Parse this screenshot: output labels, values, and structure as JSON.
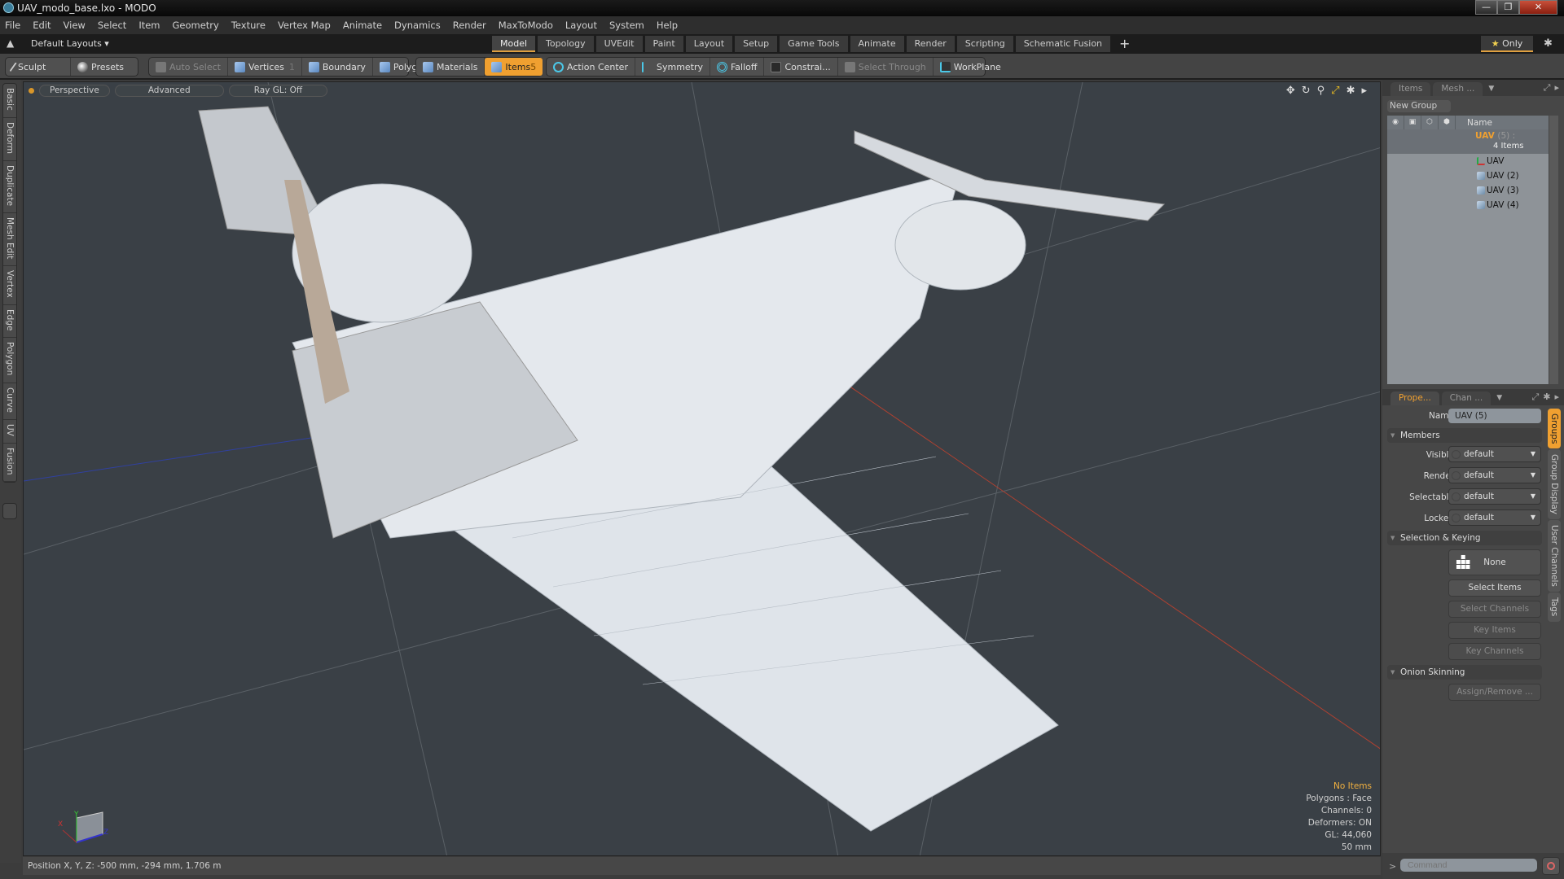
{
  "window": {
    "title": "UAV_modo_base.lxo - MODO",
    "min": "—",
    "max": "❐",
    "close": "✕"
  },
  "menu": [
    "File",
    "Edit",
    "View",
    "Select",
    "Item",
    "Geometry",
    "Texture",
    "Vertex Map",
    "Animate",
    "Dynamics",
    "Render",
    "MaxToModo",
    "Layout",
    "System",
    "Help"
  ],
  "layoutbar": {
    "layouts_label": "Default Layouts ▾",
    "tabs": [
      "Model",
      "Topology",
      "UVEdit",
      "Paint",
      "Layout",
      "Setup",
      "Game Tools",
      "Animate",
      "Render",
      "Scripting",
      "Schematic Fusion"
    ],
    "active_tab": "Model",
    "add": "+",
    "only_label": "Only",
    "star": "★",
    "gear": "✱"
  },
  "toolbar": {
    "sculpt": "Sculpt",
    "presets": "Presets",
    "auto_select": "Auto Select",
    "vertices": "Vertices",
    "vertices_count": "1",
    "boundary": "Boundary",
    "polygons": "Polygons",
    "materials": "Materials",
    "items": "Items",
    "items_count": "5",
    "action_center": "Action Center",
    "symmetry": "Symmetry",
    "falloff": "Falloff",
    "constraints": "Constrai...",
    "select_through": "Select Through",
    "workplane": "WorkPlane"
  },
  "left_tabs": [
    "Basic",
    "Deform",
    "Duplicate",
    "Mesh Edit",
    "Vertex",
    "Edge",
    "Polygon",
    "Curve",
    "UV",
    "Fusion"
  ],
  "viewport": {
    "view_mode": "Perspective",
    "shading": "Advanced",
    "raygl": "Ray GL: Off",
    "icons": [
      "move-icon",
      "rotate-icon",
      "zoom-icon",
      "maximize-icon",
      "gear-icon",
      "play-icon"
    ],
    "info": {
      "selection": "No Items",
      "polygons": "Polygons : Face",
      "channels": "Channels: 0",
      "deformers": "Deformers: ON",
      "gl": "GL: 44,060",
      "lens": "50 mm"
    },
    "axes": {
      "x": "X",
      "y": "Y",
      "z": "Z"
    }
  },
  "status": {
    "position": "Position X, Y, Z:   -500 mm, -294 mm, 1.706 m"
  },
  "items_panel": {
    "tabs": [
      "Items",
      "Mesh ..."
    ],
    "new_group": "New Group",
    "col_name": "Name",
    "group": {
      "name": "UAV",
      "count": "(5) :",
      "sub": "4 Items"
    },
    "children": [
      "UAV",
      "UAV (2)",
      "UAV (3)",
      "UAV (4)"
    ]
  },
  "properties_panel": {
    "tabs": [
      "Prope...",
      "Chan ..."
    ],
    "name_label": "Name",
    "name_value": "UAV (5)",
    "members_section": "Members",
    "members": [
      {
        "label": "Visible",
        "value": "default"
      },
      {
        "label": "Render",
        "value": "default"
      },
      {
        "label": "Selectable",
        "value": "default"
      },
      {
        "label": "Locked",
        "value": "default"
      }
    ],
    "sel_section": "Selection & Keying",
    "none_btn": "None",
    "select_items": "Select Items",
    "select_channels": "Select Channels",
    "key_items": "Key Items",
    "key_channels": "Key Channels",
    "onion_section": "Onion Skinning",
    "assign_remove": "Assign/Remove ...",
    "side_tabs": [
      "Groups",
      "Group Display",
      "User Channels",
      "Tags"
    ]
  },
  "command": {
    "prompt": ">",
    "placeholder": "Command"
  }
}
